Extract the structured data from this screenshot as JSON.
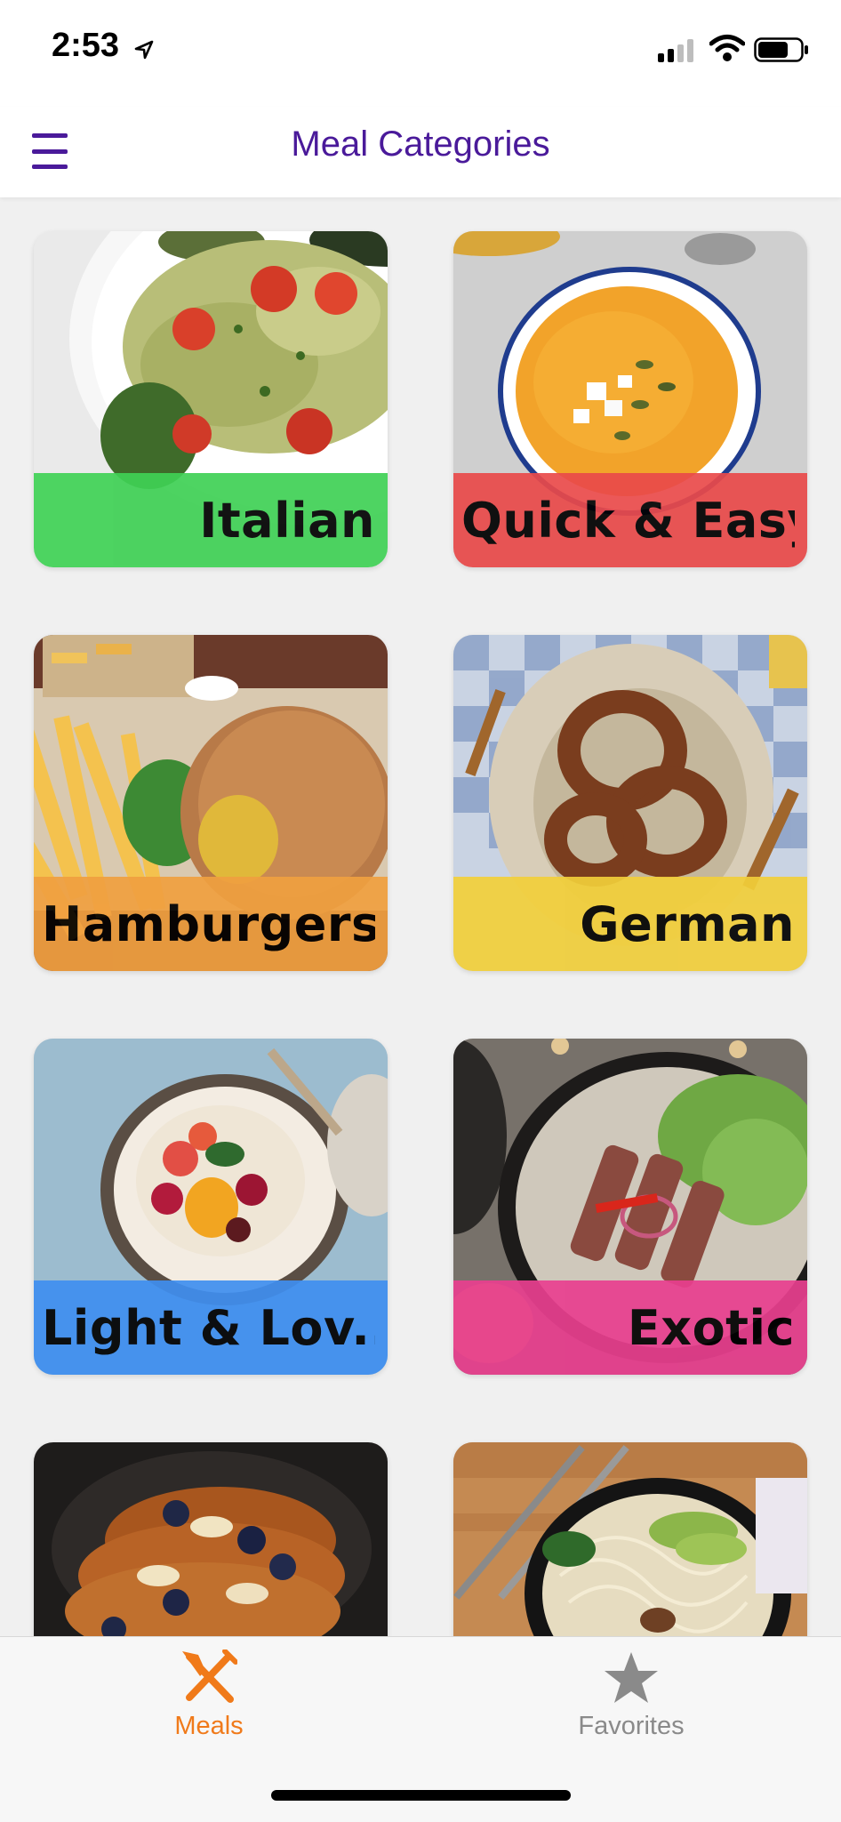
{
  "status_bar": {
    "time": "2:53"
  },
  "header": {
    "title": "Meal Categories",
    "menu_icon": "hamburger-menu-icon"
  },
  "categories": [
    {
      "label": "Italian",
      "color": "#3fd155",
      "image": "pasta-salad"
    },
    {
      "label": "Quick & Easy",
      "color": "#ea4a4a",
      "image": "pumpkin-soup"
    },
    {
      "label": "Hamburgers",
      "color": "#f0a040",
      "image": "burger-and-fries"
    },
    {
      "label": "German",
      "color": "#f2cf3a",
      "image": "pretzels"
    },
    {
      "label": "Light & Lov...",
      "color": "#3f8ff0",
      "image": "fruit-porridge"
    },
    {
      "label": "Exotic",
      "color": "#e93f8f",
      "image": "steak-salad"
    },
    {
      "label": "",
      "color": "#8b4a1e",
      "image": "french-toast"
    },
    {
      "label": "",
      "color": "#c58a52",
      "image": "noodle-bowl"
    }
  ],
  "tabs": [
    {
      "label": "Meals",
      "icon": "fork-knife-icon",
      "active": true,
      "color": "#f07a1a"
    },
    {
      "label": "Favorites",
      "icon": "star-icon",
      "active": false,
      "color": "#8a8a8a"
    }
  ]
}
